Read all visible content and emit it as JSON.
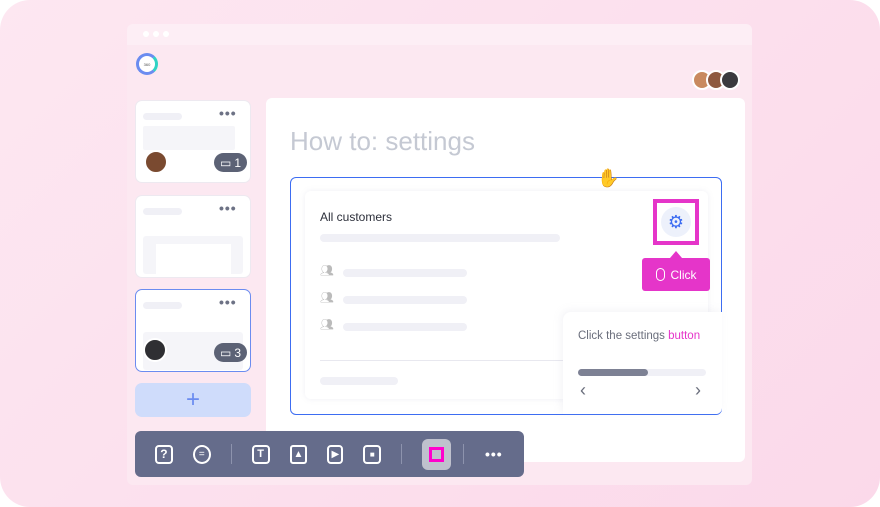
{
  "app": {
    "logo_text": "360"
  },
  "collaborators": [
    "avatar-woman-1",
    "avatar-woman-2",
    "avatar-man"
  ],
  "slides": [
    {
      "comments": "1",
      "avatar": "avatar-woman"
    },
    {
      "comments": null
    },
    {
      "comments": "3",
      "avatar": "avatar-man",
      "selected": true
    }
  ],
  "add_slide_label": "+",
  "main": {
    "title": "How to: settings",
    "card_title": "All customers",
    "click_label": "Click",
    "popup": {
      "text": "Click the settings ",
      "highlight": "button",
      "progress": 0.55
    }
  },
  "toolbar": {
    "items": [
      "question-icon",
      "comment-icon",
      "text-icon",
      "image-icon",
      "video-icon",
      "record-icon",
      "hotspot-icon",
      "more-icon"
    ],
    "active": "hotspot-icon"
  },
  "colors": {
    "accent": "#3d6df2",
    "highlight": "#e535c9",
    "toolbar": "#656c8b"
  }
}
